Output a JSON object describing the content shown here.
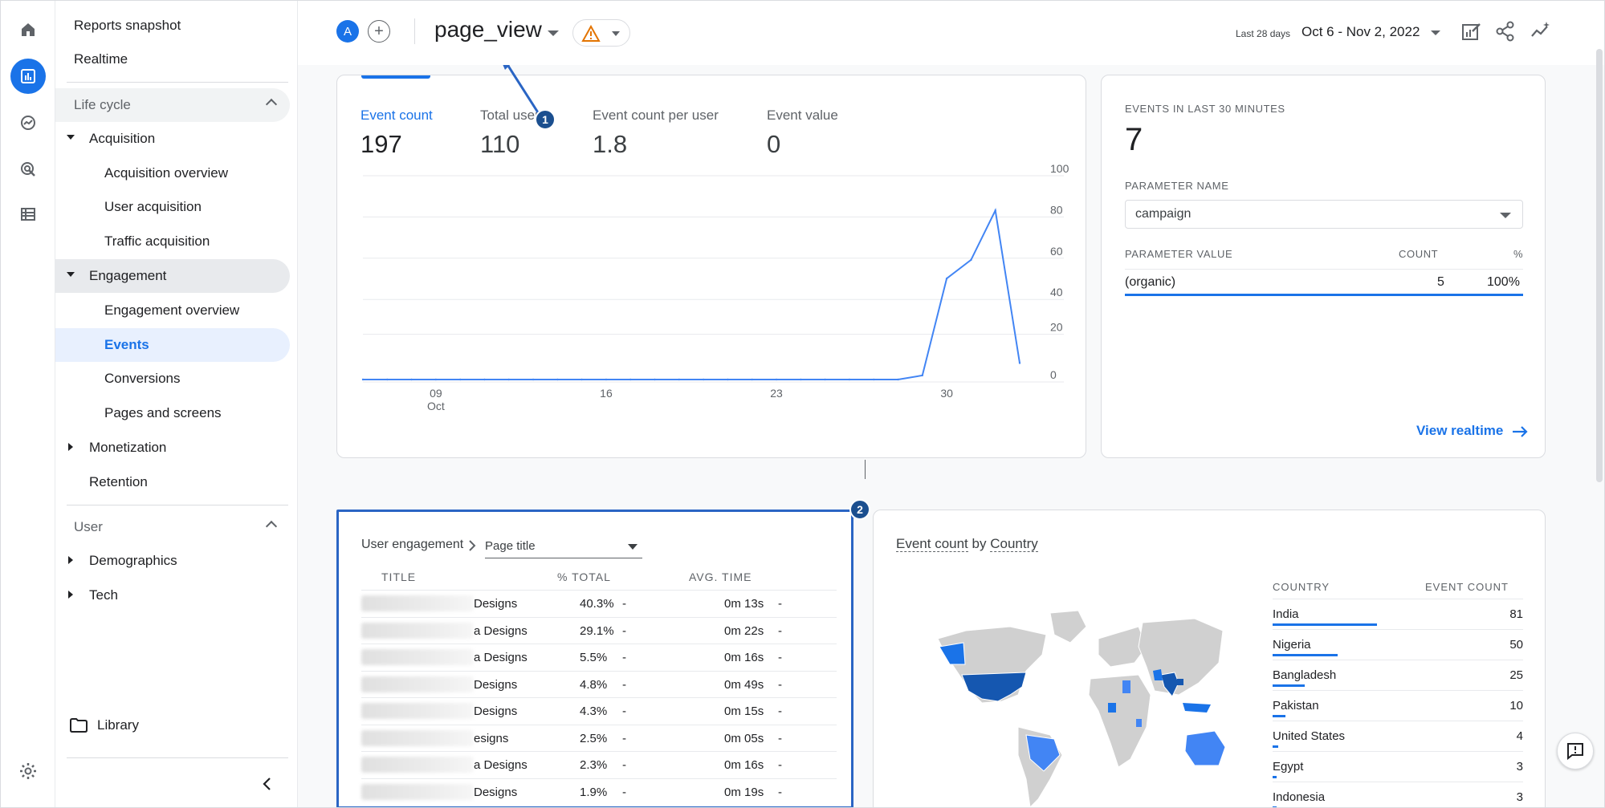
{
  "nav": {
    "reports_snapshot": "Reports snapshot",
    "realtime": "Realtime",
    "lifecycle": "Life cycle",
    "acquisition": "Acquisition",
    "acquisition_overview": "Acquisition overview",
    "user_acquisition": "User acquisition",
    "traffic_acquisition": "Traffic acquisition",
    "engagement": "Engagement",
    "engagement_overview": "Engagement overview",
    "events": "Events",
    "conversions": "Conversions",
    "pages_and_screens": "Pages and screens",
    "monetization": "Monetization",
    "retention": "Retention",
    "user": "User",
    "demographics": "Demographics",
    "tech": "Tech",
    "library": "Library"
  },
  "topbar": {
    "avatar_letter": "A",
    "event_name": "page_view",
    "date_caption": "Last 28 days",
    "date_range": "Oct 6 - Nov 2, 2022"
  },
  "metrics": [
    {
      "label": "Event count",
      "value": "197"
    },
    {
      "label": "Total users",
      "value": "110"
    },
    {
      "label": "Event count per user",
      "value": "1.8"
    },
    {
      "label": "Event value",
      "value": "0"
    }
  ],
  "chart_data": {
    "type": "line",
    "x_tick_labels": [
      "09",
      "16",
      "23",
      "30"
    ],
    "x_tick_sublabel": "Oct",
    "y_ticks": [
      "100",
      "80",
      "60",
      "40",
      "20",
      "0"
    ],
    "ylim": [
      0,
      100
    ],
    "x": [
      "Oct 6",
      "Oct 7",
      "Oct 8",
      "Oct 9",
      "Oct 10",
      "Oct 11",
      "Oct 12",
      "Oct 13",
      "Oct 14",
      "Oct 15",
      "Oct 16",
      "Oct 17",
      "Oct 18",
      "Oct 19",
      "Oct 20",
      "Oct 21",
      "Oct 22",
      "Oct 23",
      "Oct 24",
      "Oct 25",
      "Oct 26",
      "Oct 27",
      "Oct 28",
      "Oct 29",
      "Oct 30",
      "Oct 31",
      "Nov 1",
      "Nov 2"
    ],
    "values": [
      0,
      0,
      0,
      0,
      0,
      0,
      0,
      0,
      0,
      0,
      0,
      0,
      0,
      0,
      0,
      0,
      0,
      0,
      0,
      0,
      0,
      0,
      0,
      2,
      49,
      58,
      82,
      8
    ],
    "color": "#4285f4"
  },
  "realtime": {
    "title": "EVENTS IN LAST 30 MINUTES",
    "value": "7",
    "param_name_label": "PARAMETER NAME",
    "param_name_value": "campaign",
    "col_value": "PARAMETER VALUE",
    "col_count": "COUNT",
    "col_pct": "%",
    "row_value": "(organic)",
    "row_count": "5",
    "row_pct": "100%",
    "link": "View realtime"
  },
  "engagement": {
    "breadcrumb": "User engagement",
    "dimension": "Page title",
    "col_title": "TITLE",
    "col_pct": "% TOTAL",
    "col_time": "AVG. TIME",
    "rows": [
      {
        "title": "Designs",
        "pct": "40.3%",
        "pct_dash": "-",
        "time": "0m 13s",
        "time_dash": "-"
      },
      {
        "title": "a Designs",
        "pct": "29.1%",
        "pct_dash": "-",
        "time": "0m 22s",
        "time_dash": "-"
      },
      {
        "title": "a Designs",
        "pct": "5.5%",
        "pct_dash": "-",
        "time": "0m 16s",
        "time_dash": "-"
      },
      {
        "title": "Designs",
        "pct": "4.8%",
        "pct_dash": "-",
        "time": "0m 49s",
        "time_dash": "-"
      },
      {
        "title": "Designs",
        "pct": "4.3%",
        "pct_dash": "-",
        "time": "0m 15s",
        "time_dash": "-"
      },
      {
        "title": "esigns",
        "pct": "2.5%",
        "pct_dash": "-",
        "time": "0m 05s",
        "time_dash": "-"
      },
      {
        "title": "a Designs",
        "pct": "2.3%",
        "pct_dash": "-",
        "time": "0m 16s",
        "time_dash": "-"
      },
      {
        "title": "Designs",
        "pct": "1.9%",
        "pct_dash": "-",
        "time": "0m 19s",
        "time_dash": "-"
      }
    ]
  },
  "country_card": {
    "title_metric": "Event count",
    "title_by": "by",
    "title_dim": "Country",
    "col_country": "COUNTRY",
    "col_count": "EVENT COUNT",
    "rows": [
      {
        "country": "India",
        "count": "81",
        "share": 1.0
      },
      {
        "country": "Nigeria",
        "count": "50",
        "share": 0.62
      },
      {
        "country": "Bangladesh",
        "count": "25",
        "share": 0.31
      },
      {
        "country": "Pakistan",
        "count": "10",
        "share": 0.12
      },
      {
        "country": "United States",
        "count": "4",
        "share": 0.05
      },
      {
        "country": "Egypt",
        "count": "3",
        "share": 0.04
      },
      {
        "country": "Indonesia",
        "count": "3",
        "share": 0.04
      }
    ]
  },
  "annotations": {
    "badge1": "1",
    "badge2": "2"
  },
  "colors": {
    "accent": "#1a73e8",
    "line": "#4285f4",
    "badge": "#1b4f8f"
  }
}
